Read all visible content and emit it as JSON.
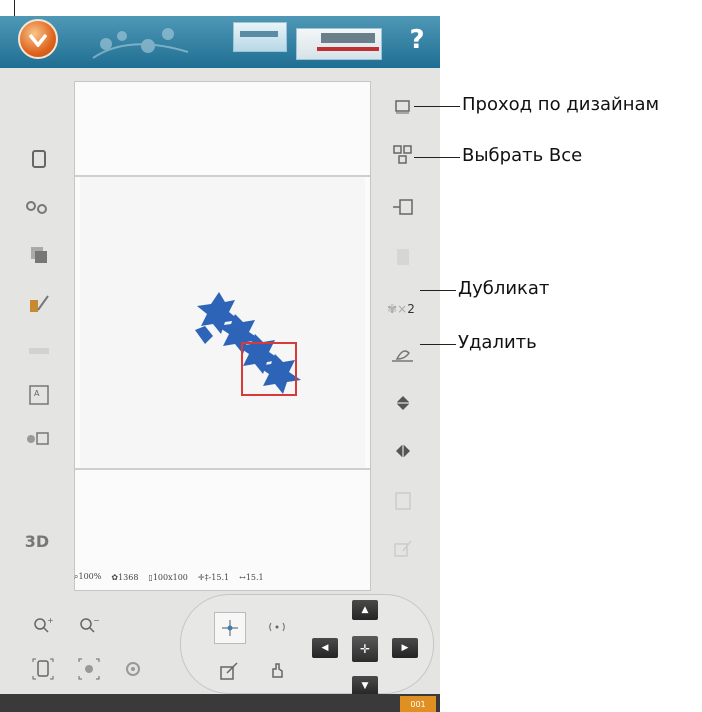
{
  "toolbar": {
    "help_label": "?"
  },
  "status": {
    "zoom": "100%",
    "stitches": "1368",
    "hoop_size": "100x100",
    "position": "-15.1",
    "position_x": "15.1"
  },
  "callouts": {
    "browse_designs": "Проход по дизайнам",
    "select_all": "Выбрать Все",
    "duplicate": "Дубликат",
    "delete": "Удалить"
  },
  "right_toolbar": {
    "duplicate_count": "2"
  },
  "left_toolbar": {
    "three_d_label": "3D"
  },
  "footer": {
    "badge": "001"
  },
  "colors": {
    "topbar": "#2f7fa3",
    "design_fill": "#2e64b8",
    "selection": "#d83a3a",
    "panel_bg": "#e4e4e2"
  },
  "icons": [
    "menu-logo-icon",
    "floral-decoration-icon",
    "embroidery-edit-thumb-icon",
    "stitch-out-thumb-icon",
    "help-icon",
    "zoom-in-icon",
    "zoom-out-icon",
    "zoom-to-hoop-icon",
    "zoom-to-all-icon",
    "pan-icon"
  ]
}
